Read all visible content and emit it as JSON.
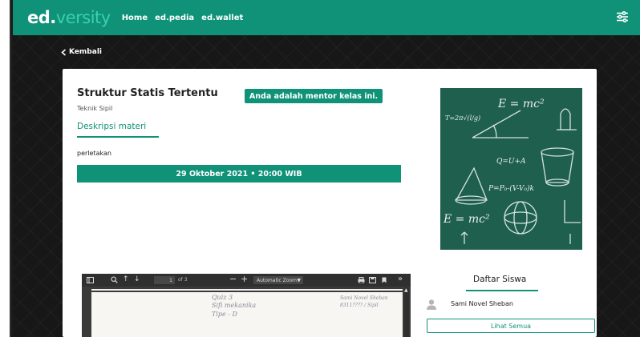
{
  "navbar": {
    "logo_part1": "ed.",
    "logo_part2": "versity",
    "links": [
      "Home",
      "ed.pedia",
      "ed.wallet"
    ],
    "settings_icon": "sliders-icon",
    "color": "#0f9277"
  },
  "back": {
    "label": "Kembali",
    "icon": "chevron-left-icon"
  },
  "course": {
    "title": "Struktur Statis Tertentu",
    "subtitle": "Teknik Sipil",
    "mentor_badge": "Anda adalah mentor kelas ini.",
    "tab_label": "Deskripsi materi",
    "description": "perletakan",
    "schedule": "29 Oktober 2021 • 20:00 WIB",
    "image_formulas": [
      "E = mc²",
      "T=2π√(l/g)",
      "Q=U+A",
      "P=P₀-(V-V₀)k",
      "E = mc²"
    ]
  },
  "pdf_viewer": {
    "page_number": "1",
    "page_of": "of 3",
    "zoom": "Automatic Zoom",
    "handwriting": [
      "Quiz 3",
      "Sifi mekanika",
      "Tipe - D",
      "Sami Novel Sheban",
      "8311???? / Sipil"
    ]
  },
  "students": {
    "heading": "Daftar Siswa",
    "items": [
      {
        "name": "Sami Novel Sheban"
      }
    ],
    "see_all_label": "Lihat Semua"
  },
  "colors": {
    "accent": "#0f9277",
    "background": "#171717",
    "chalkboard": "#1f5f4e"
  }
}
